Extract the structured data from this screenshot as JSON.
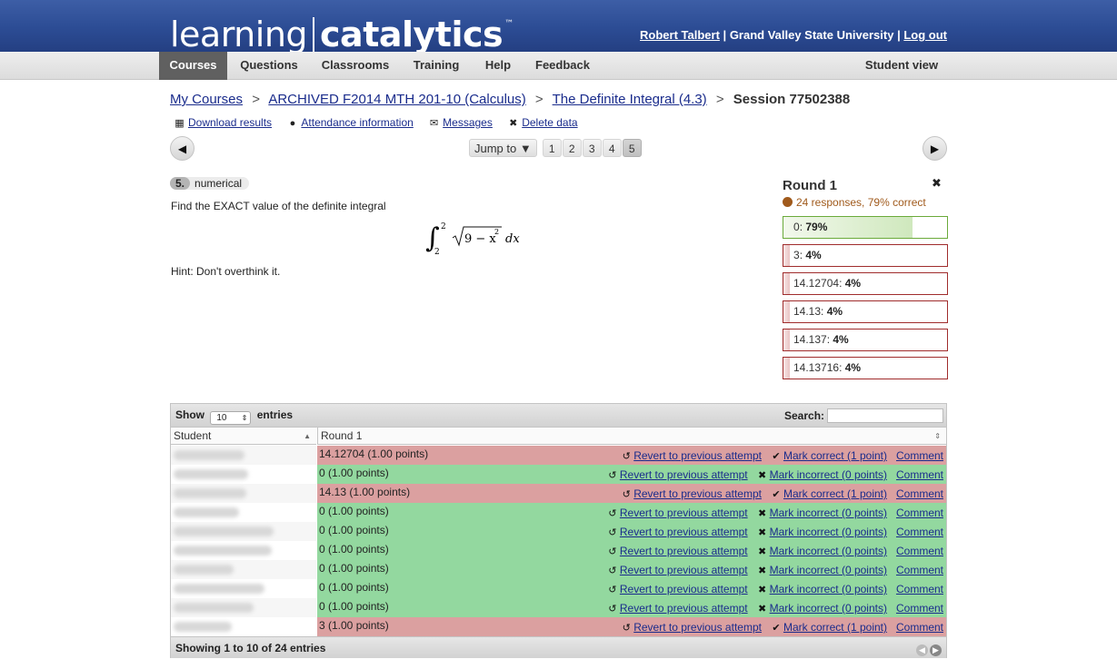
{
  "header": {
    "logo_left": "learning",
    "logo_right": "catalytics",
    "logo_tm": "™",
    "user_name": "Robert Talbert",
    "institution": "Grand Valley State University",
    "separator": "|",
    "logout": "Log out"
  },
  "nav": {
    "items": [
      "Courses",
      "Questions",
      "Classrooms",
      "Training",
      "Help",
      "Feedback"
    ],
    "student_view": "Student view"
  },
  "breadcrumb": {
    "items": [
      "My Courses",
      "ARCHIVED F2014 MTH 201-10 (Calculus)",
      "The Definite Integral (4.3)"
    ],
    "separator": ">",
    "current": "Session 77502388"
  },
  "actions": {
    "download": "Download results",
    "attendance": "Attendance information",
    "messages": "Messages",
    "delete": "Delete data"
  },
  "pager": {
    "prev": "◀",
    "next": "▶",
    "jump_label": "Jump to ▼",
    "pages": [
      "1",
      "2",
      "3",
      "4",
      "5"
    ],
    "current_page": "5"
  },
  "question": {
    "number": "5.",
    "type": "numerical",
    "text": "Find the EXACT value of the definite integral",
    "integral_lower": "2",
    "integral_upper": "2",
    "integrand": "9 − x",
    "exponent": "2",
    "differential": "dx",
    "hint": "Hint: Don't overthink it."
  },
  "round": {
    "title": "Round 1",
    "close": "✖",
    "stats": "24 responses, 79% correct",
    "responses": [
      {
        "answer": "0",
        "percent": "79%",
        "fraction": 0.79,
        "correct": true
      },
      {
        "answer": "3",
        "percent": "4%",
        "fraction": 0.04,
        "correct": false
      },
      {
        "answer": "14.12704",
        "percent": "4%",
        "fraction": 0.04,
        "correct": false
      },
      {
        "answer": "14.13",
        "percent": "4%",
        "fraction": 0.04,
        "correct": false
      },
      {
        "answer": "14.137",
        "percent": "4%",
        "fraction": 0.04,
        "correct": false
      },
      {
        "answer": "14.13716",
        "percent": "4%",
        "fraction": 0.04,
        "correct": false
      }
    ]
  },
  "table": {
    "show_label": "Show",
    "entries_value": "10",
    "entries_label": "entries",
    "search_label": "Search:",
    "col_student": "Student",
    "col_round": "Round 1",
    "revert_label": "Revert to previous attempt",
    "mark_correct_label": "Mark correct (1 point)",
    "mark_incorrect_label": "Mark incorrect (0 points)",
    "comment_label": "Comment",
    "rows": [
      {
        "value": "14.12704 (1.00 points)",
        "correct": false
      },
      {
        "value": "0 (1.00 points)",
        "correct": true
      },
      {
        "value": "14.13 (1.00 points)",
        "correct": false
      },
      {
        "value": "0 (1.00 points)",
        "correct": true
      },
      {
        "value": "0 (1.00 points)",
        "correct": true
      },
      {
        "value": "0 (1.00 points)",
        "correct": true
      },
      {
        "value": "0 (1.00 points)",
        "correct": true
      },
      {
        "value": "0 (1.00 points)",
        "correct": true
      },
      {
        "value": "0 (1.00 points)",
        "correct": true
      },
      {
        "value": "3 (1.00 points)",
        "correct": false
      }
    ],
    "footer_info": "Showing 1 to 10 of 24 entries"
  }
}
